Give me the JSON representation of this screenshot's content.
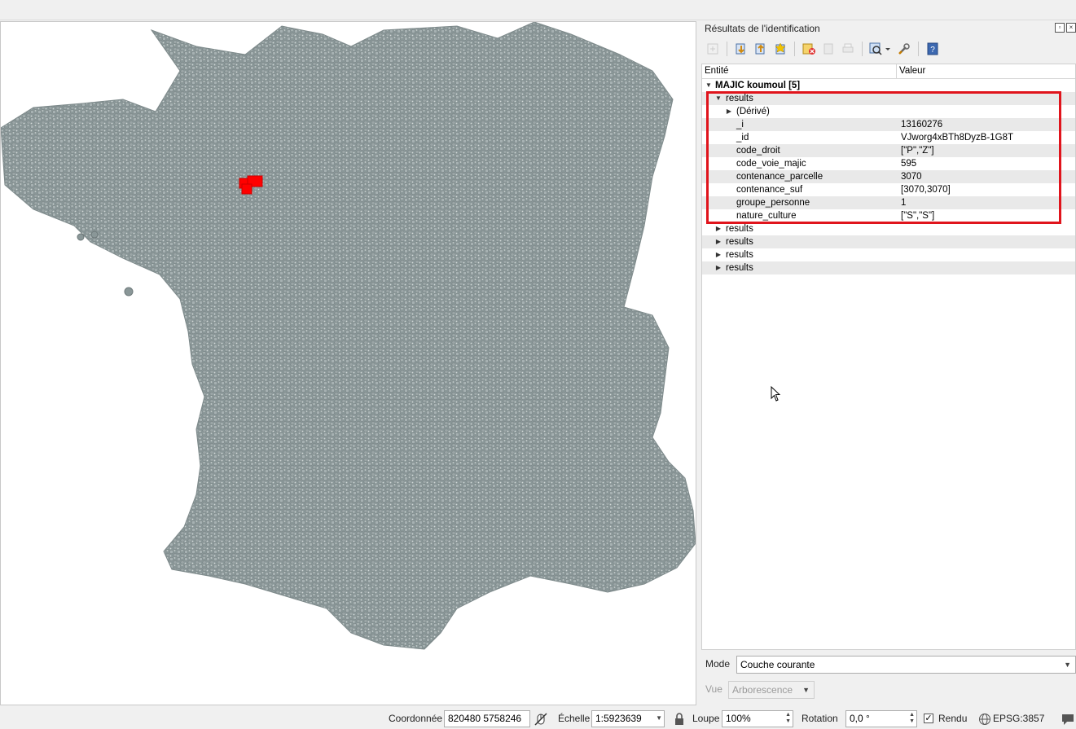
{
  "panel": {
    "title": "Résultats de l'identification",
    "col_entity": "Entité",
    "col_value": "Valeur",
    "layer_label": "MAJIC koumoul  [5]",
    "results_label": "results",
    "derived_label": "(Dérivé)",
    "attributes": [
      {
        "key": "_i",
        "value": "13160276"
      },
      {
        "key": "_id",
        "value": "VJworg4xBTh8DyzB-1G8T"
      },
      {
        "key": "code_droit",
        "value": "[\"P\",\"Z\"]"
      },
      {
        "key": "code_voie_majic",
        "value": "595"
      },
      {
        "key": "contenance_parcelle",
        "value": "3070"
      },
      {
        "key": "contenance_suf",
        "value": "[3070,3070]"
      },
      {
        "key": "groupe_personne",
        "value": "1"
      },
      {
        "key": "nature_culture",
        "value": "[\"S\",\"S\"]"
      }
    ],
    "collapsed_results": [
      "results",
      "results",
      "results",
      "results"
    ],
    "mode_label": "Mode",
    "mode_value": "Couche courante",
    "view_label": "Vue",
    "view_value": "Arborescence"
  },
  "toolbar_icons": [
    "expand-all-icon",
    "collapse-all-icon",
    "expand-new-icon",
    "clear-results-icon",
    "copy-feature-icon",
    "print-icon",
    "identify-mode-icon",
    "settings-icon",
    "help-icon"
  ],
  "statusbar": {
    "coord_label": "Coordonnée",
    "coord_value": "820480  5758246",
    "scale_label": "Échelle",
    "scale_value": "1:5923639",
    "magnifier_label": "Loupe",
    "magnifier_value": "100%",
    "rotation_label": "Rotation",
    "rotation_value": "0,0 °",
    "render_label": "Rendu",
    "render_checked": "✓",
    "crs_label": "EPSG:3857"
  },
  "colors": {
    "point_fill": "#8a9798",
    "point_stroke": "#6d7879",
    "selection": "#ff0000",
    "highlight_box": "#e0141c"
  }
}
